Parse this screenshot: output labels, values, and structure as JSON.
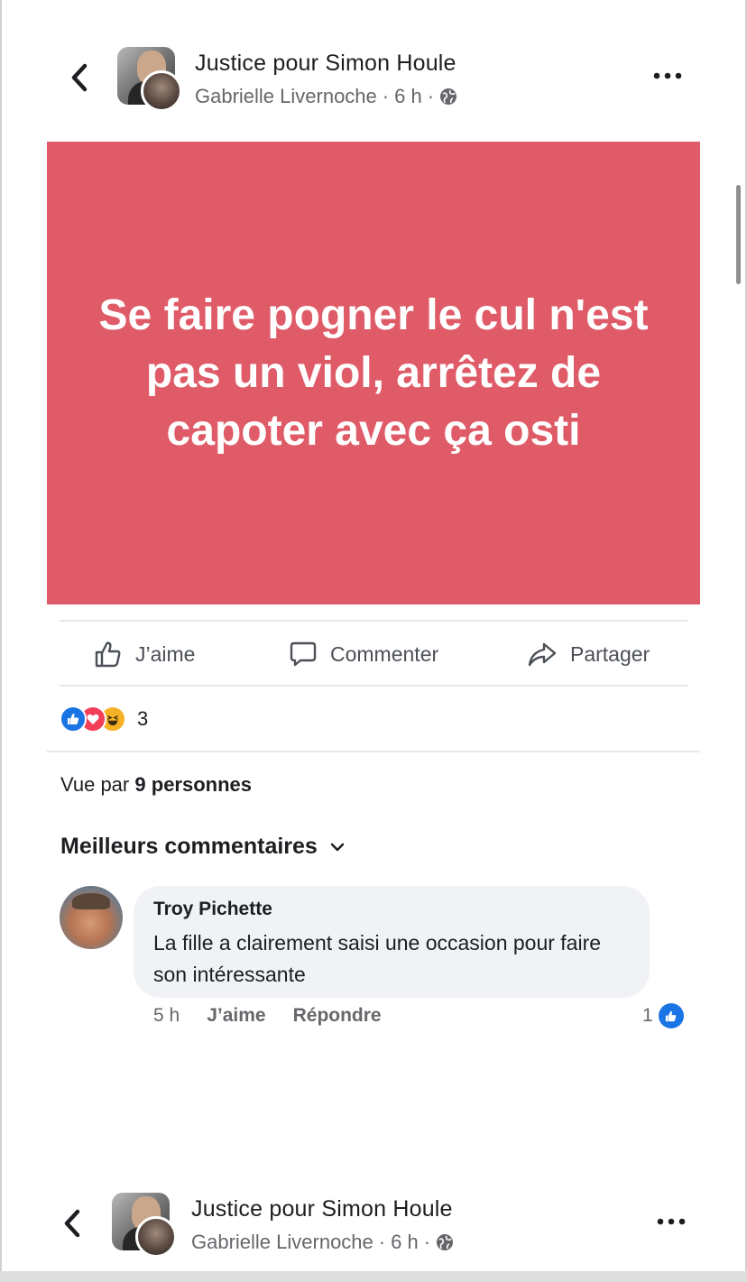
{
  "post": {
    "group_name": "Justice pour Simon Houle",
    "author": "Gabrielle Livernoche",
    "time": "6 h",
    "separator": "·",
    "card_text": "Se faire pogner le cul n'est pas un viol, arrêtez de capoter avec ça osti",
    "card_color": "#df5b68"
  },
  "actions": {
    "like": "J’aime",
    "comment": "Commenter",
    "share": "Partager"
  },
  "reactions": {
    "count": "3",
    "types": [
      "like",
      "love",
      "haha"
    ]
  },
  "seen_by": {
    "prefix": "Vue par",
    "count": "9",
    "suffix": "personnes"
  },
  "comments": {
    "filter_label": "Meilleurs commentaires",
    "items": [
      {
        "author": "Troy Pichette",
        "text": "La fille a clairement saisi une occasion pour faire son intéressante",
        "time": "5 h",
        "like_label": "J’aime",
        "reply_label": "Répondre",
        "like_count": "1"
      }
    ]
  },
  "next_post": {
    "group_name": "Justice pour Simon Houle",
    "author": "Gabrielle Livernoche",
    "time": "6 h",
    "separator": "·"
  }
}
